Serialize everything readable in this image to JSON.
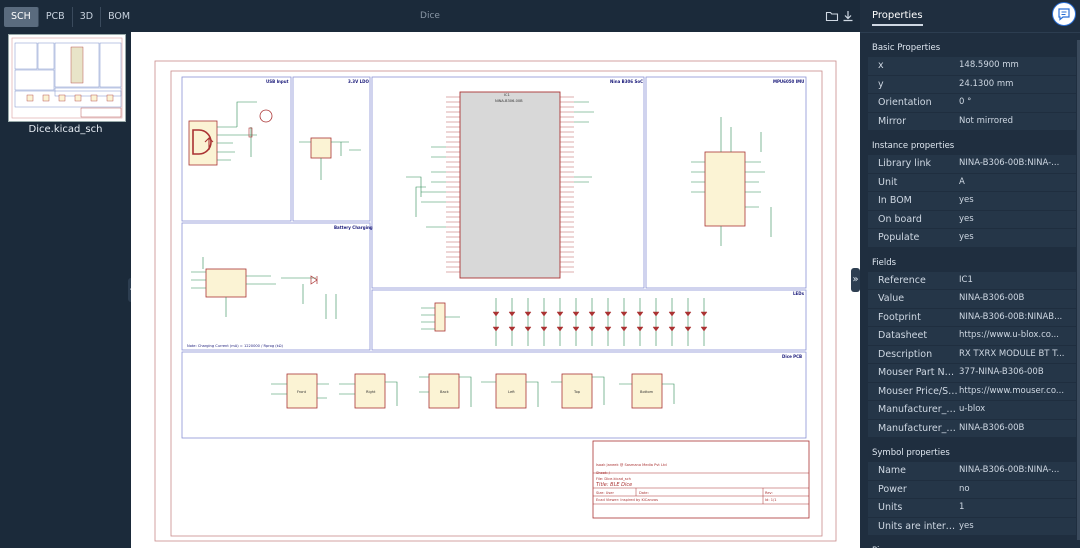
{
  "toolbar": {
    "tabs": [
      {
        "label": "SCH",
        "active": true
      },
      {
        "label": "PCB",
        "active": false
      },
      {
        "label": "3D",
        "active": false
      },
      {
        "label": "BOM",
        "active": false
      }
    ],
    "title": "Dice",
    "icons": [
      "folder-icon",
      "download-icon"
    ]
  },
  "sidebar": {
    "thumbnail_label": "Dice.kicad_sch"
  },
  "schematic": {
    "sections": [
      "USB Input",
      "3.3V LDO",
      "Nina B306 SoC",
      "MPU6050 IMU",
      "Battery Charging",
      "LEDs",
      "Dice PCB"
    ],
    "ic_label": "IC1",
    "ic_value": "NINA-B306-00B",
    "titleblock": {
      "company": "Isaak Janeek @ Sasmano Media Pvt Ltd",
      "sheet": "Sheet: /",
      "file": "File: Dice.kicad_sch",
      "title": "Title: BLE Dice",
      "size": "Size: User",
      "date": "Date:",
      "rev": "Rev:",
      "viewer": "Ecad Viewer: Inspired by KiCanvas",
      "id": "Id: 1/1"
    },
    "note": "Note: Charging Current (mA) = 1220000 / Rprog (kΩ)",
    "pads": [
      "Front",
      "Right",
      "Back",
      "Left",
      "Top",
      "Bottom"
    ]
  },
  "panel": {
    "title": "Properties",
    "sections": [
      {
        "title": "Basic Properties",
        "rows": [
          {
            "k": "x",
            "v": "148.5900 mm"
          },
          {
            "k": "y",
            "v": "24.1300 mm"
          },
          {
            "k": "Orientation",
            "v": "0 °"
          },
          {
            "k": "Mirror",
            "v": "Not mirrored"
          }
        ]
      },
      {
        "title": "Instance properties",
        "rows": [
          {
            "k": "Library link",
            "v": "NINA-B306-00B:NINA-..."
          },
          {
            "k": "Unit",
            "v": "A"
          },
          {
            "k": "In BOM",
            "v": "yes"
          },
          {
            "k": "On board",
            "v": "yes"
          },
          {
            "k": "Populate",
            "v": "yes"
          }
        ]
      },
      {
        "title": "Fields",
        "rows": [
          {
            "k": "Reference",
            "v": "IC1"
          },
          {
            "k": "Value",
            "v": "NINA-B306-00B"
          },
          {
            "k": "Footprint",
            "v": "NINA-B306-00B:NINAB..."
          },
          {
            "k": "Datasheet",
            "v": "https://www.u-blox.co..."
          },
          {
            "k": "Description",
            "v": "RX TXRX MODULE BT T..."
          },
          {
            "k": "Mouser Part Nu...",
            "v": "377-NINA-B306-00B"
          },
          {
            "k": "Mouser Price/St...",
            "v": "https://www.mouser.co..."
          },
          {
            "k": "Manufacturer_N...",
            "v": "u-blox"
          },
          {
            "k": "Manufacturer_P...",
            "v": "NINA-B306-00B"
          }
        ]
      },
      {
        "title": "Symbol properties",
        "rows": [
          {
            "k": "Name",
            "v": "NINA-B306-00B:NINA-..."
          },
          {
            "k": "Power",
            "v": "no"
          },
          {
            "k": "Units",
            "v": "1"
          },
          {
            "k": "Units are interc...",
            "v": "yes"
          }
        ]
      },
      {
        "title": "Pins",
        "rows": []
      }
    ]
  }
}
